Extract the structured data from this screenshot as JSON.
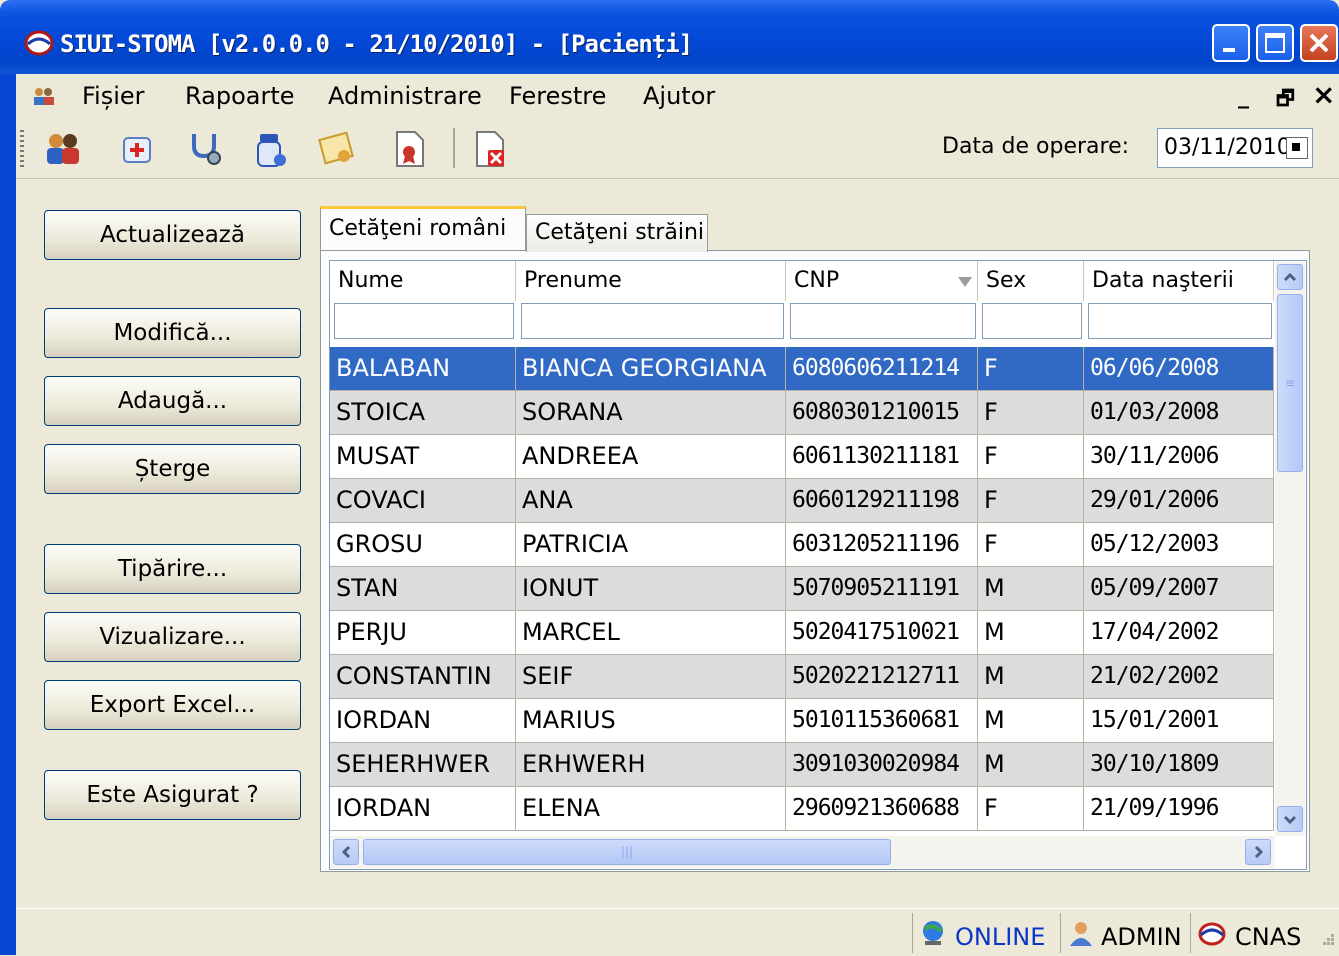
{
  "window": {
    "title": "SIUI-STOMA [v2.0.0.0 - 21/10/2010] - [Pacienți]"
  },
  "menu": {
    "items": [
      "Fișier",
      "Rapoarte",
      "Administrare",
      "Ferestre",
      "Ajutor"
    ],
    "mdi_minimize": "_",
    "mdi_restore": "🗗",
    "mdi_close": "×"
  },
  "toolbar": {
    "date_label": "Data de operare:",
    "date_value": "03/11/2010"
  },
  "actions": {
    "refresh": "Actualizează",
    "modify": "Modifică...",
    "add": "Adaugă...",
    "delete": "Șterge",
    "print": "Tipărire...",
    "preview": "Vizualizare...",
    "export_excel": "Export Excel...",
    "insured": "Este Asigurat ?"
  },
  "tabs": [
    "Cetăţeni români",
    "Cetăţeni străini"
  ],
  "grid": {
    "columns": [
      "Nume",
      "Prenume",
      "CNP",
      "Sex",
      "Data naşterii"
    ],
    "sorted_column": "CNP",
    "rows": [
      [
        "BALABAN",
        "BIANCA GEORGIANA",
        "6080606211214",
        "F",
        "06/06/2008"
      ],
      [
        "STOICA",
        "SORANA",
        "6080301210015",
        "F",
        "01/03/2008"
      ],
      [
        "MUSAT",
        "ANDREEA",
        "6061130211181",
        "F",
        "30/11/2006"
      ],
      [
        "COVACI",
        "ANA",
        "6060129211198",
        "F",
        "29/01/2006"
      ],
      [
        "GROSU",
        "PATRICIA",
        "6031205211196",
        "F",
        "05/12/2003"
      ],
      [
        "STAN",
        "IONUT",
        "5070905211191",
        "M",
        "05/09/2007"
      ],
      [
        "PERJU",
        "MARCEL",
        "5020417510021",
        "M",
        "17/04/2002"
      ],
      [
        "CONSTANTIN",
        "SEIF",
        "5020221212711",
        "M",
        "21/02/2002"
      ],
      [
        "IORDAN",
        "MARIUS",
        "5010115360681",
        "M",
        "15/01/2001"
      ],
      [
        "SEHERHWER",
        "ERHWERH",
        "3091030020984",
        "M",
        "30/10/1809"
      ],
      [
        "IORDAN",
        "ELENA",
        "2960921360688",
        "F",
        "21/09/1996"
      ]
    ]
  },
  "status": {
    "connection": "ONLINE",
    "user": "ADMIN",
    "institution": "CNAS"
  },
  "colors": {
    "title_bar": "#0348d6",
    "selection": "#316ac5",
    "alt_row": "#dcdcdc",
    "status_online": "#0a36c8"
  }
}
